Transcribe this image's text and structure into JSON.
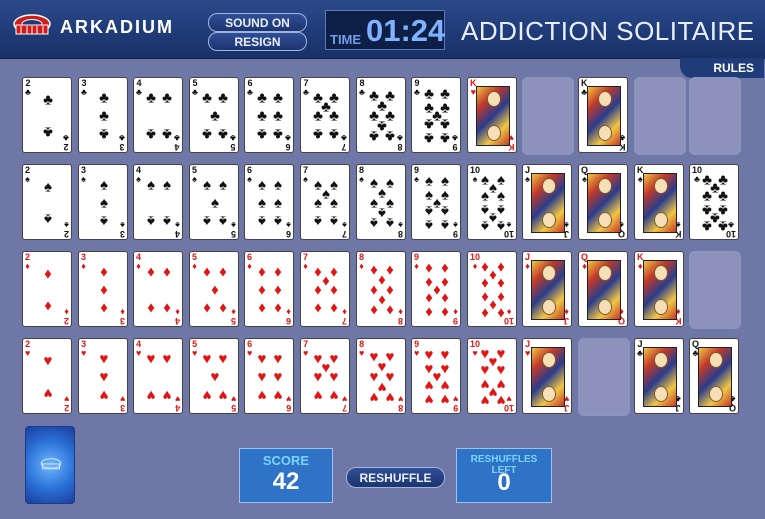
{
  "header": {
    "brand": "ARKADIUM",
    "sound_label": "SOUND ON",
    "resign_label": "RESIGN",
    "time_label": "TIME",
    "time_value": "01:24",
    "title": "ADDICTION SOLITAIRE",
    "rules_label": "RULES"
  },
  "colors": {
    "header": "#1f3b78",
    "board": "#6f77a6",
    "red_suit": "#e21515",
    "black_suit": "#111111",
    "panel": "#2f73c7"
  },
  "icons": {
    "brand_logo": "arena-logo-icon",
    "deck_logo": "arena-logo-icon"
  },
  "board": {
    "rows": [
      [
        "2♣",
        "3♣",
        "4♣",
        "5♣",
        "6♣",
        "7♣",
        "8♣",
        "9♣",
        "K♥",
        "",
        "K♣",
        "",
        ""
      ],
      [
        "2♠",
        "3♠",
        "4♠",
        "5♠",
        "6♠",
        "7♠",
        "8♠",
        "9♠",
        "10♠",
        "J♠",
        "Q♠",
        "K♠",
        "10♣"
      ],
      [
        "2♦",
        "3♦",
        "4♦",
        "5♦",
        "6♦",
        "7♦",
        "8♦",
        "9♦",
        "10♦",
        "J♦",
        "Q♦",
        "K♦",
        ""
      ],
      [
        "2♥",
        "3♥",
        "4♥",
        "5♥",
        "6♥",
        "7♥",
        "8♥",
        "9♥",
        "10♥",
        "J♥",
        "",
        "J♣",
        "Q♣"
      ]
    ]
  },
  "footer": {
    "score_label": "SCORE",
    "score_value": "42",
    "reshuffle_label": "RESHUFFLE",
    "reshuffles_left_label": "RESHUFFLES LEFT",
    "reshuffles_left_value": "0"
  }
}
